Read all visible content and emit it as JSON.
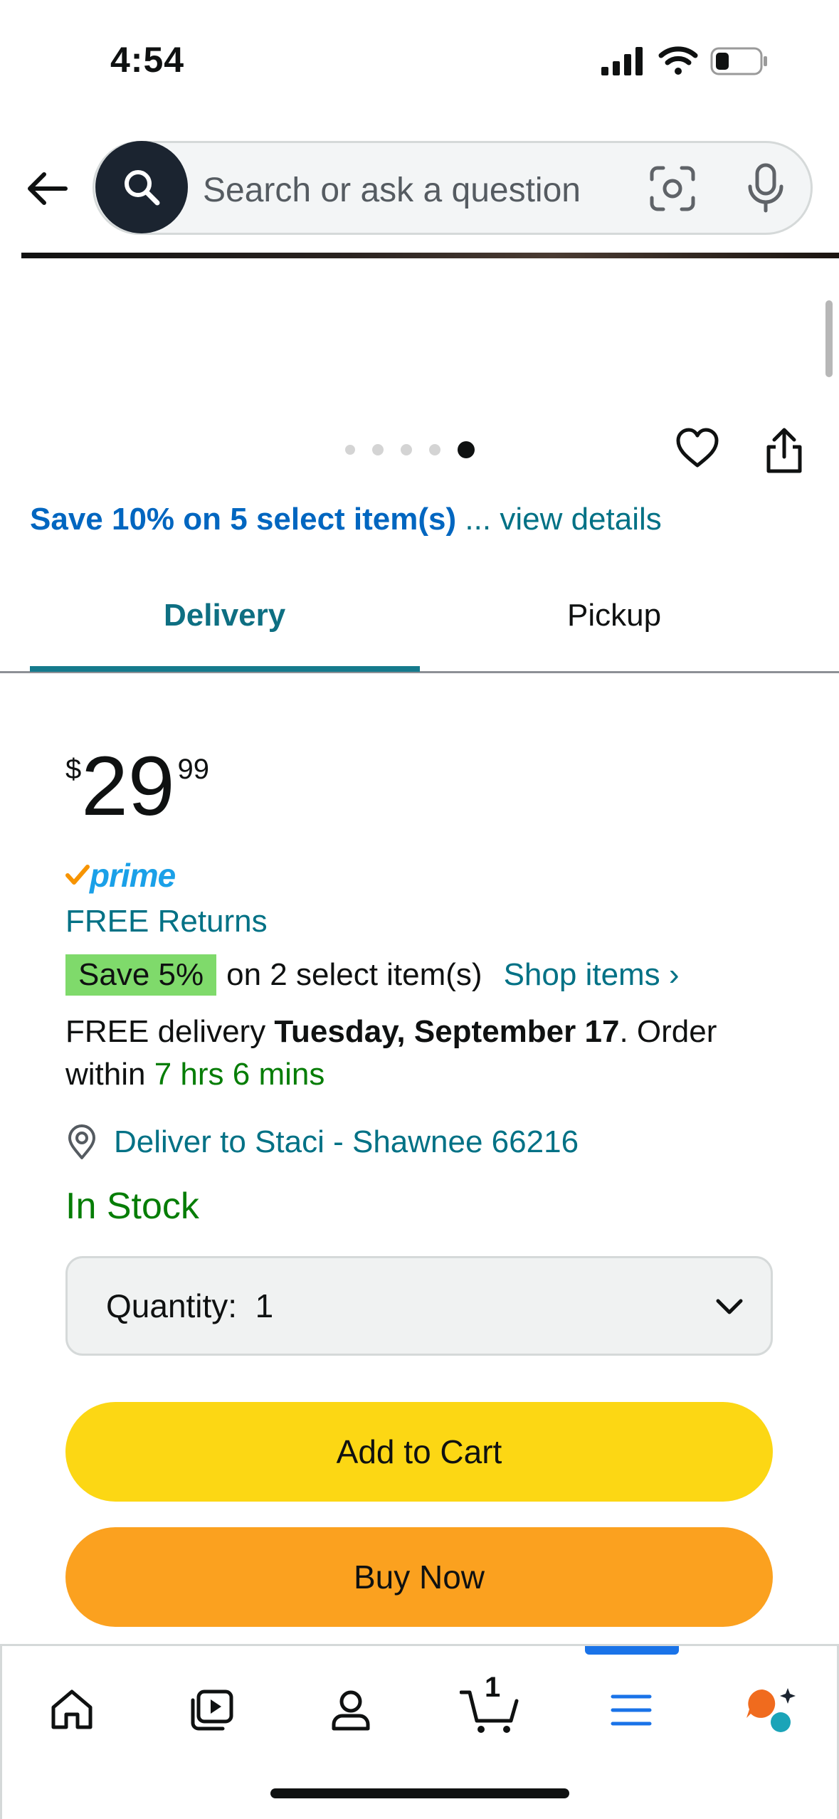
{
  "status_bar": {
    "time": "4:54"
  },
  "search": {
    "placeholder": "Search or ask a question"
  },
  "carousel": {
    "dot_count": 5,
    "active_index": 4
  },
  "deal": {
    "bold": "Save 10% on 5 select item(s)",
    "link": "... view details"
  },
  "tabs": [
    {
      "label": "Delivery",
      "selected": true
    },
    {
      "label": "Pickup",
      "selected": false
    }
  ],
  "price": {
    "symbol": "$",
    "whole": "29",
    "fraction": "99"
  },
  "prime": {
    "label": "prime"
  },
  "free_returns": "FREE Returns",
  "promo": {
    "badge": "Save 5%",
    "text": "on 2 select item(s)",
    "link": "Shop items ›"
  },
  "delivery": {
    "prefix": "FREE delivery ",
    "date": "Tuesday, September 17",
    "middle": ". Order within ",
    "countdown": "7 hrs 6 mins"
  },
  "deliver_to": "Deliver to Staci - Shawnee 66216",
  "stock": "In Stock",
  "quantity": {
    "label": "Quantity:",
    "value": "1"
  },
  "buttons": {
    "add_to_cart": "Add to Cart",
    "buy_now": "Buy Now"
  },
  "bottom_nav": {
    "items": [
      {
        "icon": "home-icon"
      },
      {
        "icon": "video-icon"
      },
      {
        "icon": "account-icon"
      },
      {
        "icon": "cart-icon",
        "count": "1"
      },
      {
        "icon": "menu-icon",
        "selected": true
      },
      {
        "icon": "rufus-assistant-icon"
      }
    ]
  },
  "colors": {
    "link": "#007185",
    "deal_blue": "#0066c0",
    "green": "#067d06",
    "add_to_cart": "#fcd714",
    "buy_now": "#fba11f",
    "save_badge": "#7fda6b",
    "nav_selected": "#1a73e8"
  }
}
